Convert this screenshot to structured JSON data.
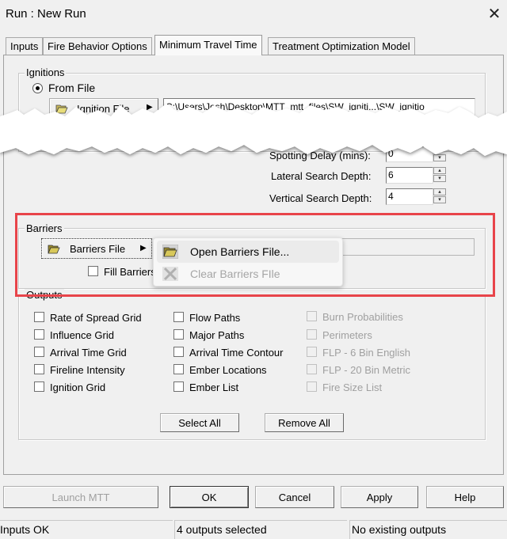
{
  "window": {
    "title": "Run : New Run",
    "close_icon": "close-icon"
  },
  "tabs": [
    {
      "label": "Inputs",
      "active": false
    },
    {
      "label": "Fire Behavior Options",
      "active": false
    },
    {
      "label": "Minimum Travel Time",
      "active": true
    },
    {
      "label": "Treatment Optimization Model",
      "active": false
    }
  ],
  "ignitions": {
    "group_label": "Ignitions",
    "from_file_label": "From File",
    "from_file_selected": true,
    "file_button_label": "Ignition File",
    "file_path": "C:\\Users\\Josh\\Desktop\\MTT_mtt_files\\SW_igniti...\\SW_ignitio"
  },
  "spotting": {
    "spotting_delay_label": "Spotting Delay (mins):",
    "spotting_delay_value": "0",
    "lateral_label": "Lateral Search Depth:",
    "lateral_value": "6",
    "vertical_label": "Vertical Search Depth:",
    "vertical_value": "4"
  },
  "barriers": {
    "group_label": "Barriers",
    "file_button_label": "Barriers File",
    "file_path": "",
    "fill_barriers_label": "Fill Barriers",
    "fill_barriers_checked": false,
    "menu": [
      {
        "label": "Open Barriers File...",
        "icon": "folder-open-icon",
        "enabled": true,
        "hovered": true
      },
      {
        "label": "Clear Barriers FIle",
        "icon": "clear-x-icon",
        "enabled": false,
        "hovered": false
      }
    ]
  },
  "outputs": {
    "group_label": "Outputs",
    "col1": [
      {
        "label": "Rate of Spread Grid",
        "checked": false,
        "enabled": true
      },
      {
        "label": "Influence Grid",
        "checked": false,
        "enabled": true
      },
      {
        "label": "Arrival Time Grid",
        "checked": false,
        "enabled": true
      },
      {
        "label": "Fireline Intensity",
        "checked": false,
        "enabled": true
      },
      {
        "label": "Ignition Grid",
        "checked": false,
        "enabled": true
      }
    ],
    "col2": [
      {
        "label": "Flow Paths",
        "checked": false,
        "enabled": true
      },
      {
        "label": "Major Paths",
        "checked": false,
        "enabled": true
      },
      {
        "label": "Arrival Time Contour",
        "checked": false,
        "enabled": true
      },
      {
        "label": "Ember Locations",
        "checked": false,
        "enabled": true
      },
      {
        "label": "Ember List",
        "checked": false,
        "enabled": true
      }
    ],
    "col3": [
      {
        "label": "Burn Probabilities",
        "checked": false,
        "enabled": false
      },
      {
        "label": "Perimeters",
        "checked": false,
        "enabled": false
      },
      {
        "label": "FLP - 6 Bin English",
        "checked": false,
        "enabled": false
      },
      {
        "label": "FLP - 20 Bin Metric",
        "checked": false,
        "enabled": false
      },
      {
        "label": "Fire Size List",
        "checked": false,
        "enabled": false
      }
    ],
    "select_all_label": "Select All",
    "remove_all_label": "Remove All"
  },
  "footer": {
    "launch_label": "Launch MTT",
    "ok_label": "OK",
    "cancel_label": "Cancel",
    "apply_label": "Apply",
    "help_label": "Help"
  },
  "status": {
    "pane1": "Inputs OK",
    "pane2": "4 outputs selected",
    "pane3": "No existing outputs"
  },
  "colors": {
    "highlight": "#e8444a",
    "background": "#f0f0f0"
  }
}
